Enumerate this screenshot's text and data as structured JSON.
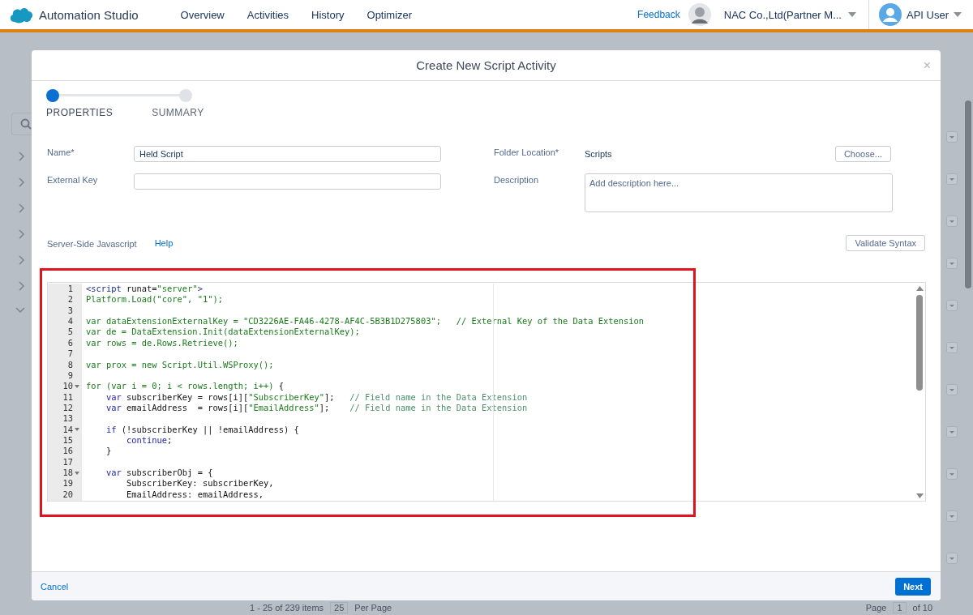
{
  "header": {
    "app_title": "Automation Studio",
    "nav": [
      {
        "label": "Overview"
      },
      {
        "label": "Activities"
      },
      {
        "label": "History"
      },
      {
        "label": "Optimizer"
      }
    ],
    "feedback": "Feedback",
    "org": "NAC Co.,Ltd(Partner M...",
    "user": "API User"
  },
  "background_footer": {
    "items_count": "1 - 25 of 239 items",
    "per_page_value": "25",
    "per_page_label": "Per Page",
    "page_label": "Page",
    "page_value": "1",
    "page_total": "of 10"
  },
  "dialog": {
    "title": "Create New Script Activity",
    "close": "×",
    "steps": [
      {
        "label": "PROPERTIES",
        "selected": true
      },
      {
        "label": "SUMMARY",
        "selected": false
      }
    ],
    "fields": {
      "name_label": "Name*",
      "name_value": "Held Script",
      "external_key_label": "External Key",
      "folder_label": "Folder Location*",
      "folder_value": "Scripts",
      "choose_button": "Choose...",
      "description_label": "Description",
      "description_placeholder": "Add description here..."
    },
    "script_label": "Server-Side Javascript",
    "help_link": "Help",
    "validate_button": "Validate Syntax",
    "code_lines": [
      {
        "number": "1",
        "foldable": false,
        "tokens": [
          {
            "kind": "tag",
            "text": "<script"
          },
          {
            "kind": "plain",
            "text": " runat="
          },
          {
            "kind": "str",
            "text": "\"server\""
          },
          {
            "kind": "tag",
            "text": ">"
          }
        ]
      },
      {
        "number": "2",
        "foldable": false,
        "tokens": [
          {
            "kind": "str",
            "text": "Platform.Load(\"core\", \"1\");"
          }
        ]
      },
      {
        "number": "3",
        "foldable": false
      },
      {
        "number": "4",
        "foldable": false,
        "tokens": [
          {
            "kind": "str",
            "text": "var dataExtensionExternalKey = \"CD3226AE-FA46-4278-AF4C-5B3B1D275803\";   // External Key of the Data Extension"
          }
        ]
      },
      {
        "number": "5",
        "foldable": false,
        "tokens": [
          {
            "kind": "str",
            "text": "var de = DataExtension.Init(dataExtensionExternalKey);"
          }
        ]
      },
      {
        "number": "6",
        "foldable": false,
        "tokens": [
          {
            "kind": "str",
            "text": "var rows = de.Rows.Retrieve();"
          }
        ]
      },
      {
        "number": "7",
        "foldable": false
      },
      {
        "number": "8",
        "foldable": false,
        "tokens": [
          {
            "kind": "str",
            "text": "var prox = new Script.Util.WSProxy();"
          }
        ]
      },
      {
        "number": "9",
        "foldable": false
      },
      {
        "number": "10",
        "foldable": true,
        "tokens": [
          {
            "kind": "str",
            "text": "for (var i = 0; i < rows.length; i++)"
          },
          {
            "kind": "plain",
            "text": " {"
          }
        ]
      },
      {
        "number": "11",
        "foldable": false,
        "tokens": [
          {
            "kind": "kw",
            "text": "    var"
          },
          {
            "kind": "plain",
            "text": " subscriberKey = rows[i]["
          },
          {
            "kind": "str",
            "text": "\"SubscriberKey\""
          },
          {
            "kind": "plain",
            "text": "];"
          },
          {
            "kind": "comment",
            "text": "   // Field name in the Data Extension"
          }
        ]
      },
      {
        "number": "12",
        "foldable": false,
        "tokens": [
          {
            "kind": "kw",
            "text": "    var"
          },
          {
            "kind": "plain",
            "text": " emailAddress  = rows[i]["
          },
          {
            "kind": "str",
            "text": "\"EmailAddress\""
          },
          {
            "kind": "plain",
            "text": "];"
          },
          {
            "kind": "comment",
            "text": "    // Field name in the Data Extension"
          }
        ]
      },
      {
        "number": "13",
        "foldable": false
      },
      {
        "number": "14",
        "foldable": true,
        "tokens": [
          {
            "kind": "kw",
            "text": "    if"
          },
          {
            "kind": "plain",
            "text": " (!subscriberKey || !emailAddress) {"
          }
        ]
      },
      {
        "number": "15",
        "foldable": false,
        "tokens": [
          {
            "kind": "kw",
            "text": "        continue"
          },
          {
            "kind": "plain",
            "text": ";"
          }
        ]
      },
      {
        "number": "16",
        "foldable": false,
        "tokens": [
          {
            "kind": "plain",
            "text": "    }"
          }
        ]
      },
      {
        "number": "17",
        "foldable": false
      },
      {
        "number": "18",
        "foldable": true,
        "tokens": [
          {
            "kind": "kw",
            "text": "    var"
          },
          {
            "kind": "plain",
            "text": " subscriberObj = {"
          }
        ]
      },
      {
        "number": "19",
        "foldable": false,
        "tokens": [
          {
            "kind": "plain",
            "text": "        SubscriberKey: subscriberKey,"
          }
        ]
      },
      {
        "number": "20",
        "foldable": false,
        "tokens": [
          {
            "kind": "plain",
            "text": "        EmailAddress: emailAddress,"
          }
        ]
      }
    ],
    "cancel": "Cancel",
    "next": "Next"
  }
}
